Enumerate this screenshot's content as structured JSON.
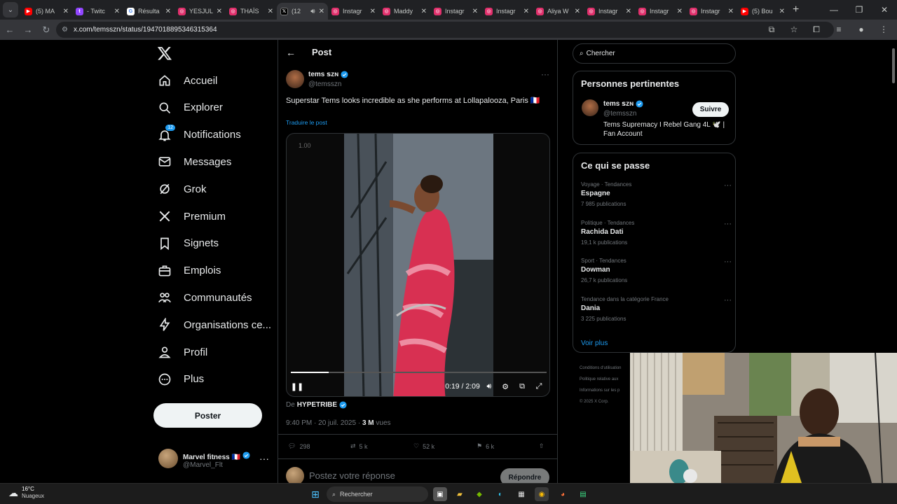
{
  "browser": {
    "tabs": [
      {
        "title": "(5) MA",
        "favicon": "youtube-icon",
        "color": "#ff0000"
      },
      {
        "title": "- Twitc",
        "favicon": "twitch-icon",
        "color": "#9146ff"
      },
      {
        "title": "Résulta",
        "favicon": "google-icon",
        "color": "#ffffff"
      },
      {
        "title": "YESJUL",
        "favicon": "instagram-icon",
        "color": "#e1306c"
      },
      {
        "title": "THAÏS",
        "favicon": "instagram-icon",
        "color": "#e1306c"
      },
      {
        "title": "(12",
        "favicon": "x-icon",
        "color": "#000000",
        "active": true
      },
      {
        "title": "Instagr",
        "favicon": "instagram-icon",
        "color": "#e1306c"
      },
      {
        "title": "Maddy",
        "favicon": "instagram-icon",
        "color": "#e1306c"
      },
      {
        "title": "Instagr",
        "favicon": "instagram-icon",
        "color": "#e1306c"
      },
      {
        "title": "Instagr",
        "favicon": "instagram-icon",
        "color": "#e1306c"
      },
      {
        "title": "Aliya W",
        "favicon": "instagram-icon",
        "color": "#e1306c"
      },
      {
        "title": "Instagr",
        "favicon": "instagram-icon",
        "color": "#e1306c"
      },
      {
        "title": "Instagr",
        "favicon": "instagram-icon",
        "color": "#e1306c"
      },
      {
        "title": "Instagr",
        "favicon": "instagram-icon",
        "color": "#e1306c"
      },
      {
        "title": "(5) Bou",
        "favicon": "youtube-icon",
        "color": "#ff0000"
      }
    ],
    "url": "x.com/temsszn/status/1947018895346315364"
  },
  "nav": {
    "items": [
      {
        "label": "Accueil",
        "icon": "home-icon"
      },
      {
        "label": "Explorer",
        "icon": "search-icon"
      },
      {
        "label": "Notifications",
        "icon": "bell-icon",
        "badge": "12"
      },
      {
        "label": "Messages",
        "icon": "envelope-icon"
      },
      {
        "label": "Grok",
        "icon": "grok-icon"
      },
      {
        "label": "Premium",
        "icon": "x-icon"
      },
      {
        "label": "Signets",
        "icon": "bookmark-icon"
      },
      {
        "label": "Emplois",
        "icon": "briefcase-icon"
      },
      {
        "label": "Communautés",
        "icon": "people-icon"
      },
      {
        "label": "Organisations ce...",
        "icon": "lightning-icon"
      },
      {
        "label": "Profil",
        "icon": "person-icon"
      },
      {
        "label": "Plus",
        "icon": "more-circle-icon"
      }
    ],
    "post_button": "Poster",
    "account": {
      "name": "Marvel fitness",
      "flag": "🇫🇷",
      "handle": "@Marvel_Flt",
      "more": "···"
    }
  },
  "post": {
    "header_title": "Post",
    "author": {
      "name": "tems ꜱᴢɴ",
      "handle": "@temsszn"
    },
    "text": "Superstar Tems looks incredible as she performs at Lollapalooza, Paris 🇫🇷",
    "translate": "Traduire le post",
    "video": {
      "speed": "1.00",
      "time": "0:19 / 2:09",
      "progress": 0.147
    },
    "from_prefix": "De",
    "from_name": "HYPETRIBE",
    "timestamp": "9:40 PM · 20 juil. 2025 · ",
    "views_count": "3 M",
    "views_label": " vues",
    "actions": {
      "replies": "298",
      "reposts": "5 k",
      "likes": "52 k",
      "bookmarks": "6 k"
    },
    "reply_placeholder": "Postez votre réponse",
    "reply_button": "Répondre"
  },
  "sidebar": {
    "search_placeholder": "Chercher",
    "relevant": {
      "title": "Personnes pertinentes",
      "name": "tems ꜱᴢɴ",
      "handle": "@temsszn",
      "bio": "Tems Supremacy I Rebel Gang 4L 🕊️ | Fan Account",
      "follow": "Suivre"
    },
    "trends": {
      "title": "Ce qui se passe",
      "items": [
        {
          "context": "Voyage · Tendances",
          "name": "Espagne",
          "count": "7 985 publications"
        },
        {
          "context": "Politique · Tendances",
          "name": "Rachida Dati",
          "count": "19,1 k publications"
        },
        {
          "context": "Sport · Tendances",
          "name": "Dowman",
          "count": "26,7 k publications"
        },
        {
          "context": "Tendance dans la catégorie France",
          "name": "Dania",
          "count": "3 225 publications"
        }
      ],
      "see_more": "Voir plus"
    },
    "footer": [
      "Conditions d'utilisation",
      "Politique relative aux",
      "Informations sur les p",
      "© 2025 X Corp."
    ]
  },
  "taskbar": {
    "weather_temp": "16°C",
    "weather_desc": "Nuageux",
    "search": "Rechercher"
  }
}
